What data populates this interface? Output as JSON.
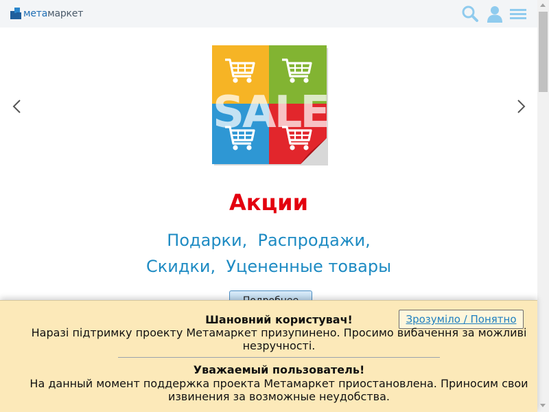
{
  "header": {
    "logo_part1": "мета",
    "logo_part2": "маркет"
  },
  "icons": {
    "search": "search-icon",
    "user": "user-icon",
    "menu": "menu-icon",
    "prev": "chevron-left-icon",
    "next": "chevron-right-icon"
  },
  "slide": {
    "banner_text": "SALE",
    "title": "Акции",
    "links_line1": [
      "Подарки",
      "Распродажи"
    ],
    "links_line2": [
      "Скидки",
      "Уцененные товары"
    ],
    "separator": ",",
    "button_label": "Подробнее"
  },
  "notice": {
    "close_label": "Зрозуміло / Понятно",
    "heading_uk": "Шановний користувач!",
    "text_uk": "Наразі підтримку проекту Метамаркет призупинено. Просимо вибачення за можливі незручності.",
    "heading_ru": "Уважаемый пользователь!",
    "text_ru": "На данный момент поддержка проекта Метамаркет приостановлена. Приносим свои извинения за возможные неудобства."
  },
  "colors": {
    "accent_blue": "#1e8bc3",
    "title_red": "#e3000f",
    "notice_bg": "#fce9b9",
    "header_bg": "#f3f5f7"
  }
}
